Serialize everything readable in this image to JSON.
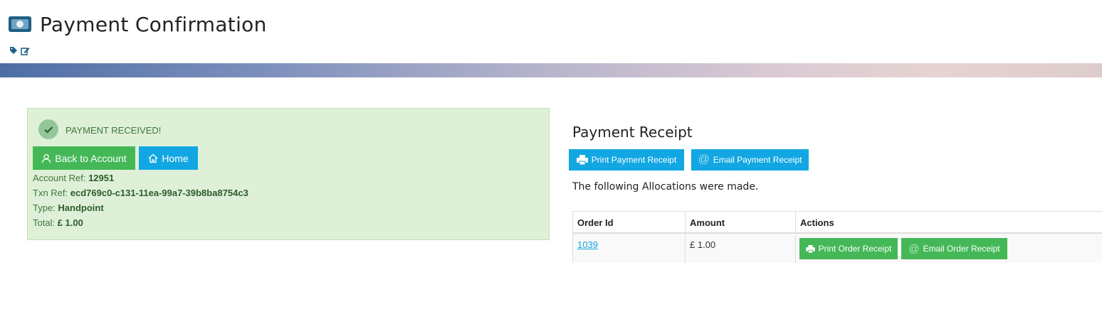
{
  "header": {
    "title": "Payment Confirmation",
    "icon": "money-icon"
  },
  "alert": {
    "title": "PAYMENT RECEIVED!",
    "back_label": "Back to Account",
    "home_label": "Home",
    "account_ref_label": "Account Ref:",
    "account_ref": "12951",
    "txn_ref_label": "Txn Ref:",
    "txn_ref": "ecd769c0-c131-11ea-99a7-39b8ba8754c3",
    "type_label": "Type:",
    "type": "Handpoint",
    "total_label": "Total:",
    "total": "£ 1.00"
  },
  "receipt": {
    "title": "Payment Receipt",
    "print_label": "Print Payment Receipt",
    "email_label": "Email Payment Receipt",
    "allocations_text": "The following Allocations were made."
  },
  "table": {
    "headers": [
      "Order Id",
      "Amount",
      "Actions"
    ],
    "rows": [
      {
        "order_id": "1039",
        "amount": "£ 1.00",
        "print_label": "Print Order Receipt",
        "email_label": "Email Order Receipt"
      }
    ]
  },
  "colors": {
    "green": "#44b857",
    "blue": "#12a7e2",
    "alert_bg": "#dff0d8",
    "alert_text": "#3c763d"
  }
}
